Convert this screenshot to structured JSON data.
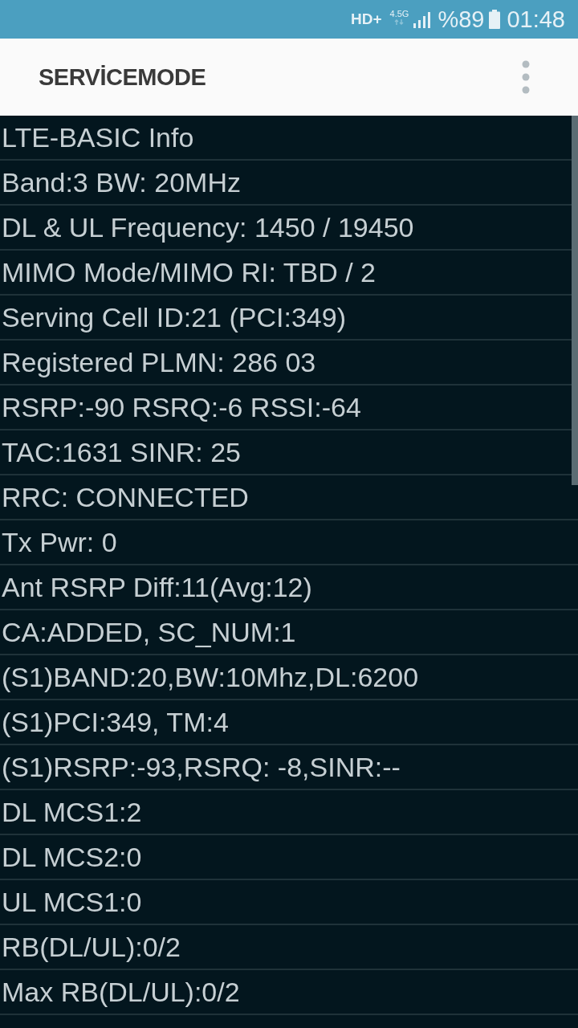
{
  "status_bar": {
    "network": "HD+",
    "data_type": "4.5G",
    "battery": "%89",
    "time": "01:48"
  },
  "app_bar": {
    "title": "SERVİCEMODE"
  },
  "rows": [
    "LTE-BASIC Info",
    "Band:3 BW: 20MHz",
    "DL & UL Frequency: 1450 / 19450",
    "MIMO Mode/MIMO RI: TBD / 2",
    "Serving Cell ID:21 (PCI:349)",
    "Registered PLMN: 286 03",
    "RSRP:-90 RSRQ:-6 RSSI:-64",
    "TAC:1631 SINR: 25",
    "RRC: CONNECTED",
    "Tx Pwr: 0",
    "Ant RSRP Diff:11(Avg:12)",
    "CA:ADDED, SC_NUM:1",
    "(S1)BAND:20,BW:10Mhz,DL:6200",
    "(S1)PCI:349, TM:4",
    "(S1)RSRP:-93,RSRQ: -8,SINR:--",
    "DL MCS1:2",
    "DL MCS2:0",
    "UL MCS1:0",
    "RB(DL/UL):0/2",
    "Max RB(DL/UL):0/2"
  ]
}
